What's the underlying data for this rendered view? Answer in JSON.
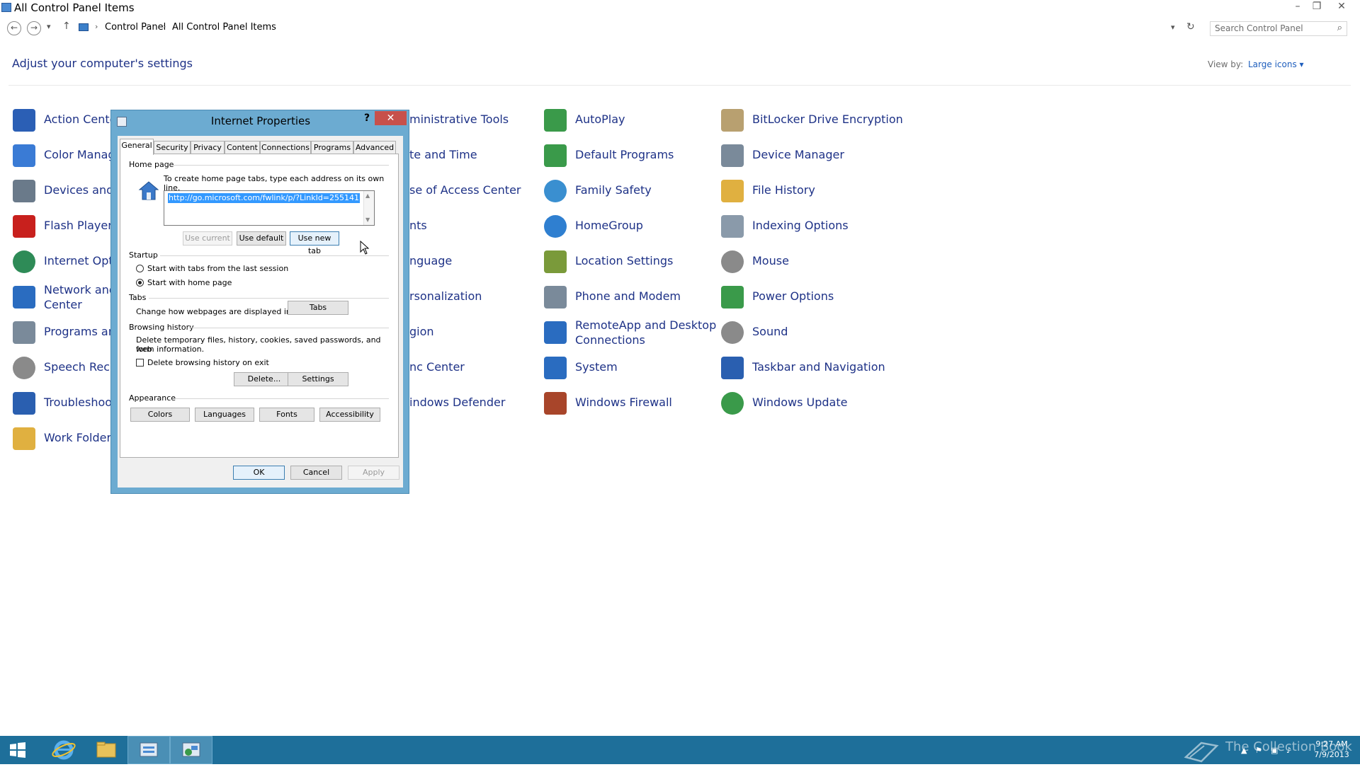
{
  "window": {
    "title": "All Control Panel Items",
    "minimize": "–",
    "restore": "❐",
    "close": "✕"
  },
  "address": {
    "back": "←",
    "forward": "→",
    "history": "▾",
    "up": "↑",
    "crumbs": [
      "Control Panel",
      "All Control Panel Items"
    ],
    "separator": "›",
    "dropdown": "▾",
    "refresh": "↻",
    "search_placeholder": "Search Control Panel",
    "search_icon": "⌕"
  },
  "main": {
    "heading": "Adjust your computer's settings",
    "view_by_label": "View by:",
    "view_by_value": "Large icons ▾"
  },
  "items": [
    {
      "label": "Action Center",
      "icon": "flag-icon",
      "color": "#2b5fb5"
    },
    {
      "label": "Color Manag",
      "icon": "color-management-icon",
      "color": "#3a7bd5"
    },
    {
      "label": "Devices and P",
      "icon": "printer-icon",
      "color": "#6a7a8a"
    },
    {
      "label": "Flash Player (",
      "icon": "flash-icon",
      "color": "#c8201d"
    },
    {
      "label": "Internet Optic",
      "icon": "globe-icon",
      "color": "#2e8b57"
    },
    {
      "label": "Network and",
      "label2": "Center",
      "icon": "network-icon",
      "color": "#2a6cc0"
    },
    {
      "label": "Programs and",
      "icon": "programs-icon",
      "color": "#7a8a9a"
    },
    {
      "label": "Speech Recog",
      "icon": "microphone-icon",
      "color": "#8a8a8a"
    },
    {
      "label": "Troubleshooti",
      "icon": "troubleshooting-icon",
      "color": "#2a5fb0"
    },
    {
      "label": "Work Folders",
      "icon": "folder-icon",
      "color": "#e0b040"
    },
    {
      "label": "ministrative Tools",
      "icon": "admin-tools-icon",
      "color": "#888"
    },
    {
      "label": "te and Time",
      "icon": "clock-icon",
      "color": "#888"
    },
    {
      "label": "se of Access Center",
      "icon": "access-icon",
      "color": "#888"
    },
    {
      "label": "nts",
      "icon": "fonts-icon",
      "color": "#888"
    },
    {
      "label": "nguage",
      "icon": "language-icon",
      "color": "#888"
    },
    {
      "label": "rsonalization",
      "icon": "personalization-icon",
      "color": "#888"
    },
    {
      "label": "gion",
      "icon": "region-icon",
      "color": "#888"
    },
    {
      "label": "nc Center",
      "icon": "sync-icon",
      "color": "#888"
    },
    {
      "label": "indows Defender",
      "icon": "defender-icon",
      "color": "#888"
    },
    {
      "label": "AutoPlay",
      "icon": "autoplay-icon",
      "color": "#3a9a4a"
    },
    {
      "label": "Default Programs",
      "icon": "default-programs-icon",
      "color": "#3a9a4a"
    },
    {
      "label": "Family Safety",
      "icon": "family-safety-icon",
      "color": "#3a8fd0"
    },
    {
      "label": "HomeGroup",
      "icon": "homegroup-icon",
      "color": "#2f7fd0"
    },
    {
      "label": "Location Settings",
      "icon": "location-icon",
      "color": "#7a9a3a"
    },
    {
      "label": "Phone and Modem",
      "icon": "phone-icon",
      "color": "#7a8a9a"
    },
    {
      "label": "RemoteApp and Desktop",
      "label2": "Connections",
      "icon": "remoteapp-icon",
      "color": "#2a6cc0"
    },
    {
      "label": "System",
      "icon": "system-icon",
      "color": "#2a6cc0"
    },
    {
      "label": "Windows Firewall",
      "icon": "firewall-icon",
      "color": "#a8452a"
    },
    {
      "label": "BitLocker Drive Encryption",
      "icon": "bitlocker-icon",
      "color": "#b8a070"
    },
    {
      "label": "Device Manager",
      "icon": "device-manager-icon",
      "color": "#7a8a9a"
    },
    {
      "label": "File History",
      "icon": "file-history-icon",
      "color": "#e0b040"
    },
    {
      "label": "Indexing Options",
      "icon": "indexing-icon",
      "color": "#8a9aaa"
    },
    {
      "label": "Mouse",
      "icon": "mouse-icon",
      "color": "#8a8a8a"
    },
    {
      "label": "Power Options",
      "icon": "power-icon",
      "color": "#3a9a4a"
    },
    {
      "label": "Sound",
      "icon": "sound-icon",
      "color": "#8a8a8a"
    },
    {
      "label": "Taskbar and Navigation",
      "icon": "taskbar-icon",
      "color": "#2a5fb0"
    },
    {
      "label": "Windows Update",
      "icon": "update-icon",
      "color": "#3a9a4a"
    }
  ],
  "dialog": {
    "title": "Internet Properties",
    "help": "?",
    "close": "✕",
    "tabs": [
      "General",
      "Security",
      "Privacy",
      "Content",
      "Connections",
      "Programs",
      "Advanced"
    ],
    "home_page": {
      "group": "Home page",
      "instruction": "To create home page tabs, type each address on its own line.",
      "url": "http://go.microsoft.com/fwlink/p/?LinkId=255141",
      "use_current": "Use current",
      "use_default": "Use default",
      "use_new_tab": "Use new tab"
    },
    "startup": {
      "group": "Startup",
      "option1": "Start with tabs from the last session",
      "option2": "Start with home page"
    },
    "tabs_group": {
      "group": "Tabs",
      "text": "Change how webpages are displayed in tabs.",
      "button": "Tabs"
    },
    "history": {
      "group": "Browsing history",
      "text1": "Delete temporary files, history, cookies, saved passwords, and web",
      "text2": "form information.",
      "checkbox": "Delete browsing history on exit",
      "delete": "Delete...",
      "settings": "Settings"
    },
    "appearance": {
      "group": "Appearance",
      "colors": "Colors",
      "languages": "Languages",
      "fonts": "Fonts",
      "accessibility": "Accessibility"
    },
    "ok": "OK",
    "cancel": "Cancel",
    "apply": "Apply"
  },
  "taskbar": {
    "time": "9:27 AM",
    "date": "7/9/2013",
    "watermark": "The Collection Book"
  }
}
